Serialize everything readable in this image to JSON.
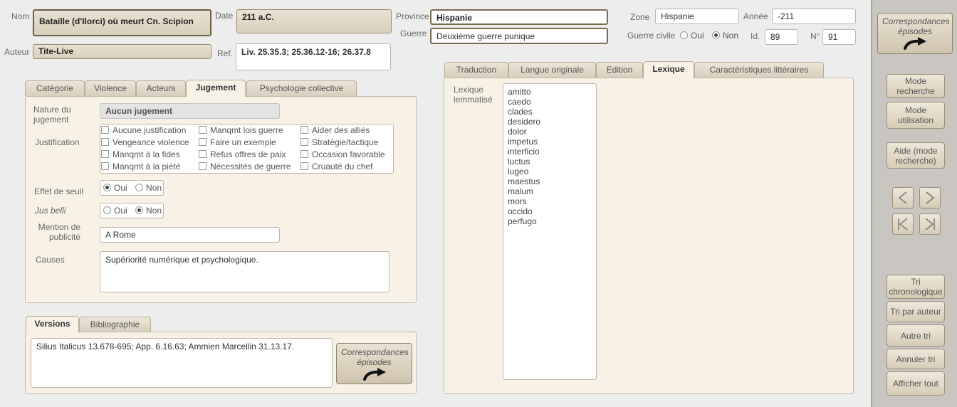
{
  "header": {
    "nom_label": "Nom",
    "nom_value": "Bataille (d'Ilorci) où meurt Cn. Scipion",
    "date_label": "Date",
    "date_value": "211 a.C.",
    "auteur_label": "Auteur",
    "auteur_value": "Tite-Live",
    "ref_label": "Ref.",
    "ref_value": "Liv. 25.35.3; 25.36.12-16; 26.37.8",
    "province_label": "Province",
    "province_value": "Hispanie",
    "guerre_label": "Guerre",
    "guerre_value": "Deuxième guerre punique",
    "zone_label": "Zone",
    "zone_value": "Hispanie",
    "annee_label": "Année",
    "annee_value": "-211",
    "guerre_civile_label": "Guerre civile",
    "guerre_civile_oui": "Oui",
    "guerre_civile_non": "Non",
    "guerre_civile_selected": "Non",
    "id_label": "Id.",
    "id_value": "89",
    "num_label": "N°",
    "num_value": "91"
  },
  "left_tabs": {
    "items": [
      "Catégorie",
      "Violence",
      "Acteurs",
      "Jugement",
      "Psychologie collective"
    ],
    "active": "Jugement"
  },
  "jugement": {
    "nature_label": "Nature du jugement",
    "nature_value": "Aucun jugement",
    "justification_label": "Justification",
    "justification_options": [
      "Aucune justification",
      "Manqmt lois guerre",
      "Aider des alliés",
      "Vengeance violence",
      "Faire un exemple",
      "Stratégie/tactique",
      "Manqmt à la fides",
      "Refus offres de paix",
      "Occasion favorable",
      "Manqmt à la piété",
      "Nécessités de guerre",
      "Cruauté du chef"
    ],
    "effet_label": "Effet de seuil",
    "effet_oui": "Oui",
    "effet_non": "Non",
    "effet_selected": "Oui",
    "jus_label": "Jus belli",
    "jus_oui": "Oui",
    "jus_non": "Non",
    "jus_selected": "Non",
    "publicite_label": "Mention de publicité",
    "publicite_value": "A Rome",
    "causes_label": "Causes",
    "causes_value": "Supériorité numérique et psychologique."
  },
  "bottom_tabs": {
    "items": [
      "Versions",
      "Bibliographie"
    ],
    "active": "Versions"
  },
  "versions": {
    "value": "Silius Italicus 13.678-695; App. 6.16.63; Ammien Marcellin 31.13.17.",
    "corr_button": "Correspondances épisodes"
  },
  "right_tabs": {
    "items": [
      "Traduction",
      "Langue originale",
      "Edition",
      "Lexique",
      "Caractéristiques littéraires"
    ],
    "active": "Lexique"
  },
  "lexique": {
    "label": "Lexique lemmatisé",
    "words": [
      "amitto",
      "caedo",
      "clades",
      "desidero",
      "dolor",
      "impetus",
      "interficio",
      "luctus",
      "lugeo",
      "maestus",
      "malum",
      "mors",
      "occido",
      "perfugo"
    ]
  },
  "sidebar": {
    "corr_button": "Correspondances épisodes",
    "mode_recherche": "Mode recherche",
    "mode_utilisation": "Mode utilisation",
    "aide": "Aide (mode recherche)",
    "tri_chrono": "Tri chronologique",
    "tri_auteur": "Tri par auteur",
    "autre_tri": "Autre tri",
    "annuler_tri": "Annuler tri",
    "afficher_tout": "Afficher tout"
  }
}
